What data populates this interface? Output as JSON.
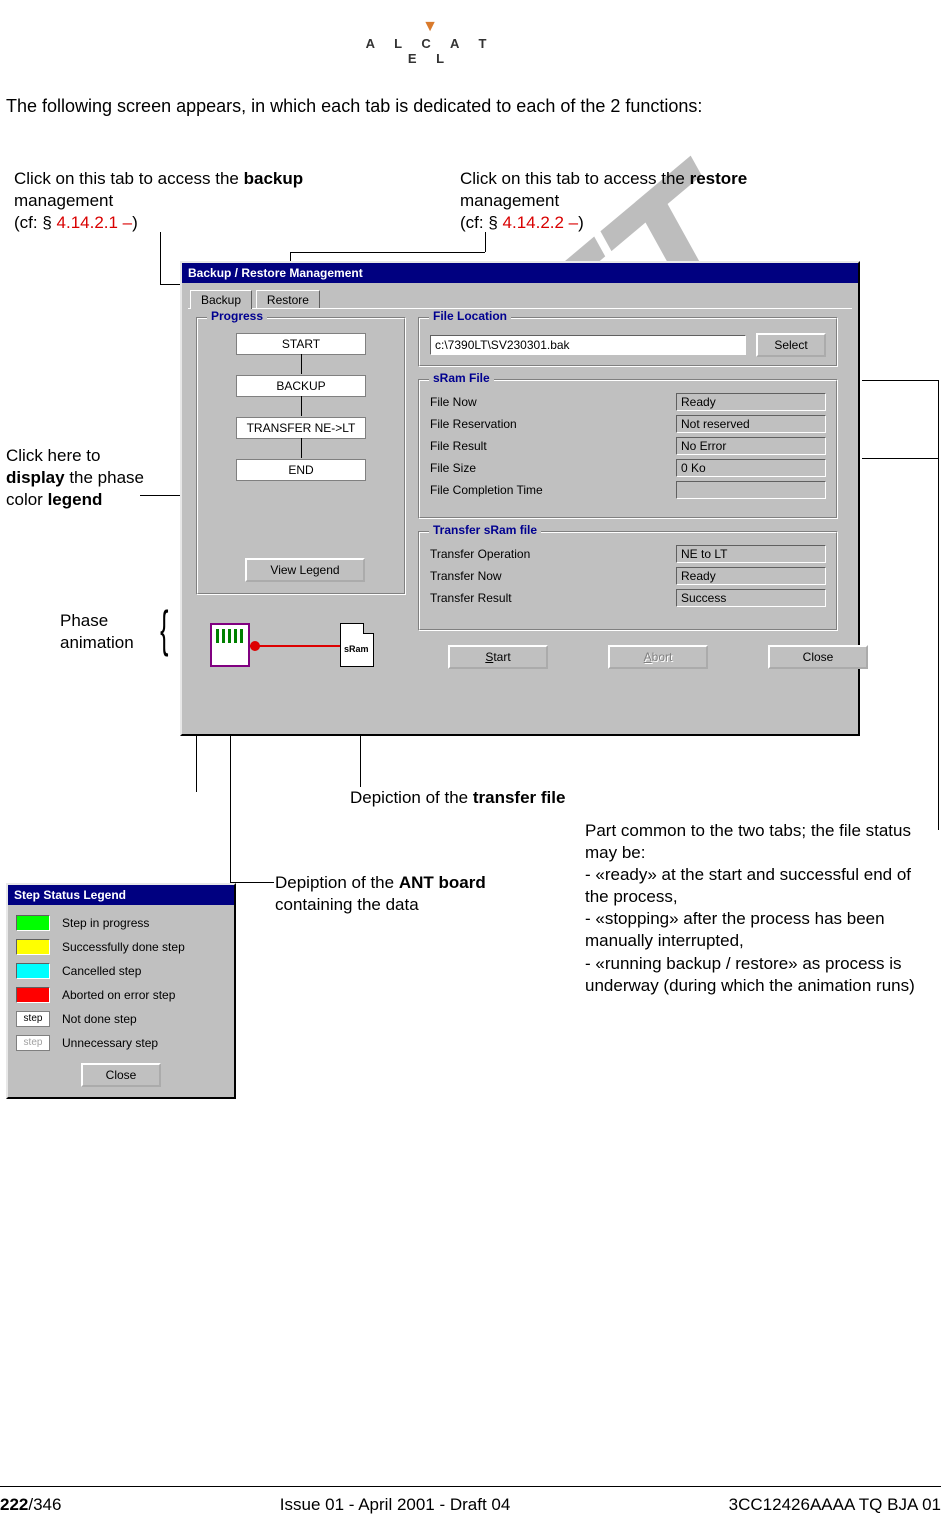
{
  "header": {
    "brand": "A L C A T E L"
  },
  "intro": "The following screen appears, in which each tab is dedicated to each of the 2 functions:",
  "callouts": {
    "backup_tab": {
      "pre": "Click on this tab to access the ",
      "bold": "backup",
      "post": " management",
      "cf_pre": "(cf: § ",
      "ref": "4.14.2.1 –",
      "cf_post": ")"
    },
    "restore_tab": {
      "pre": "Click on this tab to access the ",
      "bold": "restore",
      "post": " management",
      "cf_pre": "(cf: § ",
      "ref": "4.14.2.2 –",
      "cf_post": ")"
    },
    "view_legend": {
      "pre": "Click here to ",
      "bold1": "display",
      "mid": " the phase color ",
      "bold2": "legend"
    },
    "phase_anim": "Phase animation",
    "transfer_file": {
      "pre": "Depiction of the ",
      "bold": "transfer file"
    },
    "ant_board": {
      "pre": "Depiption of the ",
      "bold": "ANT board",
      "post": " containing the data"
    },
    "common": "Part common to the two tabs; the file status may be:\n- «ready» at the start and successful end of the process,\n- «stopping» after the process has been manually interrupted,\n- «running backup / restore» as process is underway (during which the animation runs)"
  },
  "app": {
    "title": "Backup / Restore Management",
    "tabs": {
      "backup": "Backup",
      "restore": "Restore"
    },
    "progress": {
      "title": "Progress",
      "steps": [
        "START",
        "BACKUP",
        "TRANSFER NE->LT",
        "END"
      ],
      "view_legend_btn": "View Legend"
    },
    "file_location": {
      "title": "File Location",
      "value": "c:\\7390LT\\SV230301.bak",
      "select_btn": "Select"
    },
    "sram": {
      "title": "sRam File",
      "rows": [
        {
          "label": "File Now",
          "value": "Ready"
        },
        {
          "label": "File Reservation",
          "value": "Not reserved"
        },
        {
          "label": "File Result",
          "value": "No Error"
        },
        {
          "label": "File Size",
          "value": "0 Ko"
        },
        {
          "label": "File Completion Time",
          "value": ""
        }
      ]
    },
    "transfer": {
      "title": "Transfer sRam file",
      "rows": [
        {
          "label": "Transfer Operation",
          "value": "NE to LT"
        },
        {
          "label": "Transfer Now",
          "value": "Ready"
        },
        {
          "label": "Transfer Result",
          "value": "Success"
        }
      ]
    },
    "anim_doc_label": "sRam",
    "buttons": {
      "start": "Start",
      "abort": "Abort",
      "close": "Close"
    }
  },
  "legend": {
    "title": "Step Status Legend",
    "rows": [
      {
        "color": "#00ff00",
        "label": "Step in progress"
      },
      {
        "color": "#ffff00",
        "label": "Successfully done step"
      },
      {
        "color": "#00ffff",
        "label": "Cancelled step"
      },
      {
        "color": "#ff0000",
        "label": "Aborted on error step"
      },
      {
        "box": "step",
        "gray": false,
        "label": "Not done step"
      },
      {
        "box": "step",
        "gray": true,
        "label": "Unnecessary step"
      }
    ],
    "close": "Close"
  },
  "watermark": "DRAFT",
  "footer": {
    "page_bold": "222",
    "page_total": "/346",
    "center": "Issue 01 - April 2001 - Draft 04",
    "right": "3CC12426AAAA TQ BJA 01"
  }
}
